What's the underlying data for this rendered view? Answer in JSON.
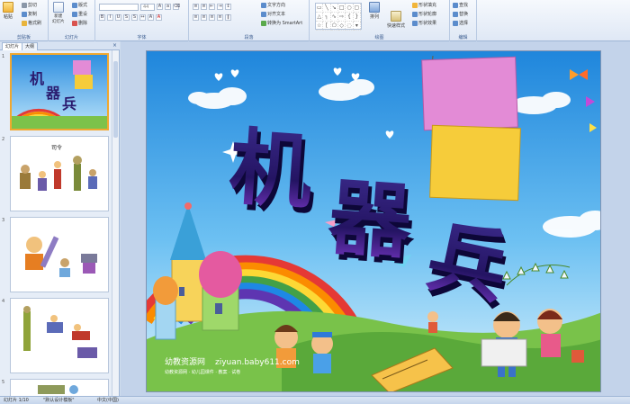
{
  "ribbon": {
    "clipboard": {
      "paste": "粘贴",
      "cut": "剪切",
      "copy": "复制",
      "format_painter": "格式刷",
      "label": "剪贴板"
    },
    "slides": {
      "new_slide": "新建\n幻灯片",
      "layout": "版式",
      "reset": "重设",
      "delete": "删除",
      "label": "幻灯片"
    },
    "font": {
      "font_size": "44",
      "label": "字体"
    },
    "paragraph": {
      "text_direction": "文字方向",
      "align_text": "对齐文本",
      "convert_smartart": "转换为 SmartArt",
      "label": "段落"
    },
    "drawing": {
      "arrange": "排列",
      "quick_styles": "快速样式",
      "shape_fill": "形状填充",
      "shape_outline": "形状轮廓",
      "shape_effects": "形状效果",
      "label": "绘图"
    },
    "editing": {
      "find": "查找",
      "replace": "替换",
      "select": "选择",
      "label": "编辑"
    }
  },
  "panel": {
    "tabs": [
      "幻灯片",
      "大纲"
    ],
    "close": "×",
    "thumb_numbers": [
      "1",
      "2",
      "3",
      "4",
      "5"
    ],
    "thumb2_title": "司令"
  },
  "slide": {
    "title_chars": [
      "机",
      "器",
      "兵"
    ],
    "watermark_cn": "幼教资源网",
    "watermark_url": "ziyuan.baby611.com",
    "watermark_sub": "幼教资源网 · 幼儿园课件 · 教案 · 试卷"
  },
  "status": {
    "slide_count": "幻灯片 1/10",
    "theme": "\"默认设计模板\"",
    "language": "中文(中国)"
  },
  "colors": {
    "sky": "#3aa0e8",
    "title_purple": "#2a1a6e",
    "pink_card": "#e38bd6",
    "yellow_card": "#f6cc3a"
  }
}
